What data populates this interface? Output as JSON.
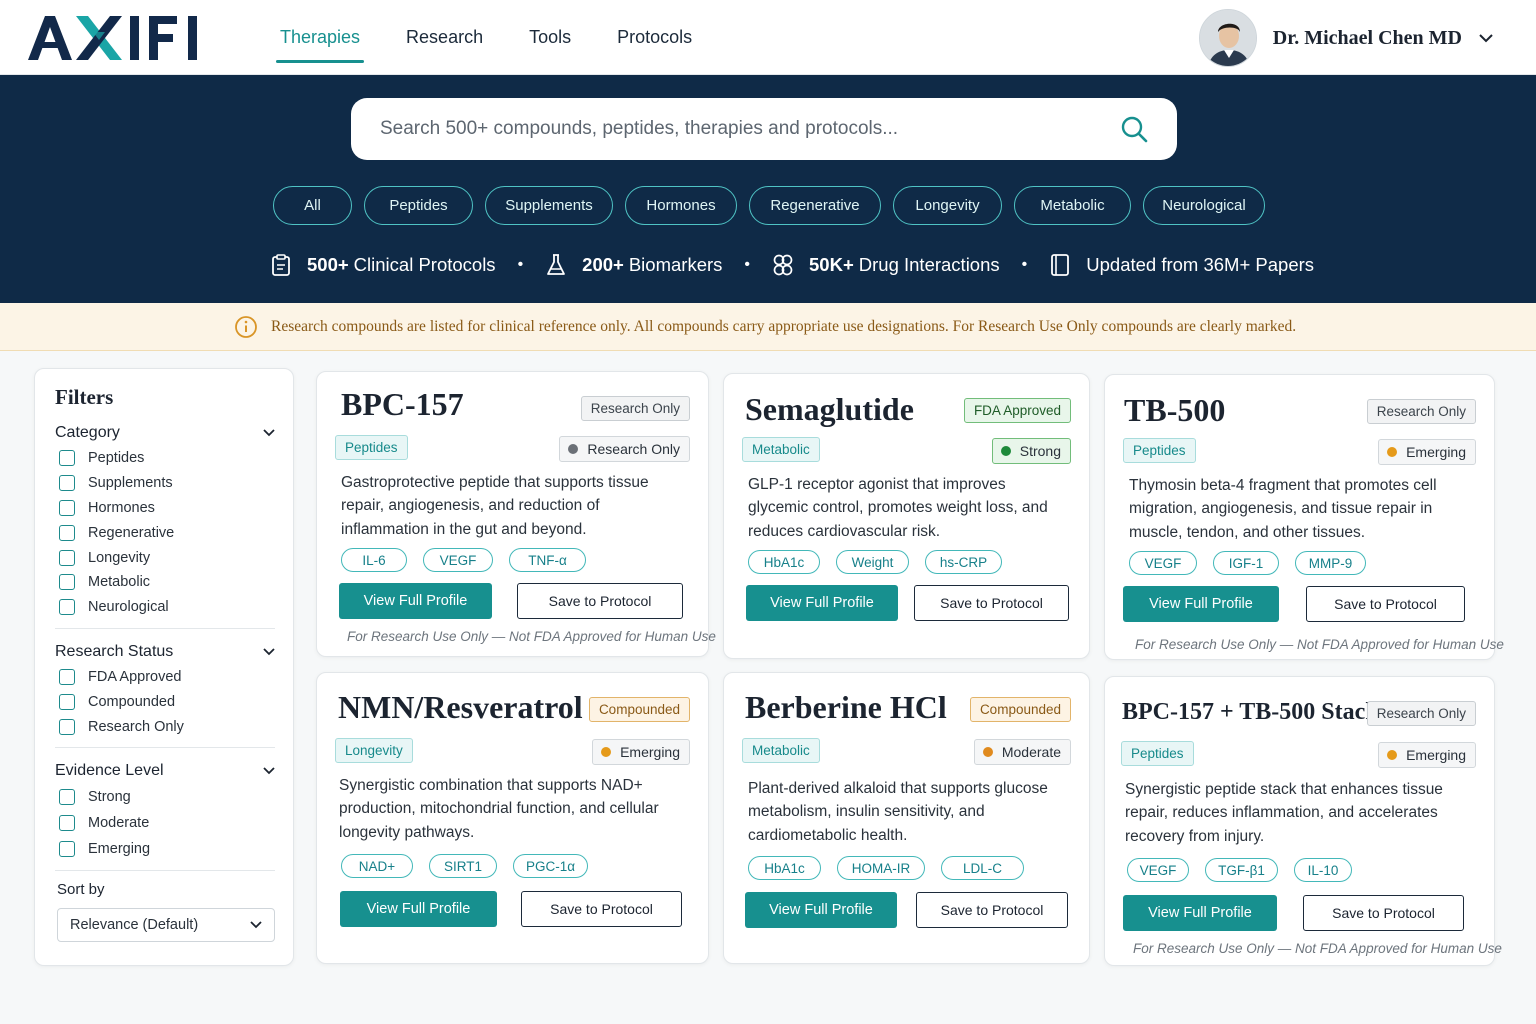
{
  "brand": {
    "logo_text": "AXIFI"
  },
  "nav": {
    "tabs": [
      {
        "label": "Therapies",
        "active": true
      },
      {
        "label": "Research",
        "active": false
      },
      {
        "label": "Tools",
        "active": false
      },
      {
        "label": "Protocols",
        "active": false
      }
    ]
  },
  "user": {
    "name": "Dr. Michael Chen MD"
  },
  "search": {
    "placeholder": "Search 500+ compounds, peptides, therapies and protocols..."
  },
  "chips": [
    "All",
    "Peptides",
    "Supplements",
    "Hormones",
    "Regenerative",
    "Longevity",
    "Metabolic",
    "Neurological"
  ],
  "stats": [
    {
      "icon": "clipboard-icon",
      "bold": "500+",
      "text": "Clinical Protocols"
    },
    {
      "icon": "flask-icon",
      "bold": "200+",
      "text": "Biomarkers"
    },
    {
      "icon": "molecule-icon",
      "bold": "50K+",
      "text": "Drug Interactions"
    },
    {
      "icon": "book-icon",
      "bold": "",
      "text": "Updated from 36M+ Papers"
    }
  ],
  "notice": {
    "text": "Research compounds are listed for clinical reference only. All compounds carry appropriate use designations. For Research Use Only compounds are clearly marked."
  },
  "filters": {
    "title": "Filters",
    "groups": [
      {
        "label": "Category",
        "options": [
          "Peptides",
          "Supplements",
          "Hormones",
          "Regenerative",
          "Longevity",
          "Metabolic",
          "Neurological"
        ]
      },
      {
        "label": "Research Status",
        "options": [
          "FDA Approved",
          "Compounded",
          "Research Only"
        ]
      },
      {
        "label": "Evidence Level",
        "options": [
          "Strong",
          "Moderate",
          "Emerging"
        ]
      }
    ],
    "sort_label": "Sort by",
    "sort_value": "Relevance (Default)"
  },
  "cards": [
    {
      "title": "BPC-157",
      "status": "Research Only",
      "status_type": "research",
      "category": "Peptides",
      "evidence": "Research Only",
      "evidence_type": "research",
      "description": "Gastroprotective peptide that supports tissue repair, angiogenesis, and reduction of inflammation in the gut and beyond.",
      "markers": [
        "IL-6",
        "VEGF",
        "TNF-α"
      ],
      "primary": "View Full Profile",
      "secondary": "Save to Protocol",
      "disclaimer": "For Research Use Only — Not FDA Approved for Human Use"
    },
    {
      "title": "Semaglutide",
      "status": "FDA Approved",
      "status_type": "fda",
      "category": "Metabolic",
      "evidence": "Strong",
      "evidence_type": "strong",
      "description": "GLP-1 receptor agonist that improves glycemic control, promotes weight loss, and reduces cardiovascular risk.",
      "markers": [
        "HbA1c",
        "Weight",
        "hs-CRP"
      ],
      "primary": "View Full Profile",
      "secondary": "Save to Protocol",
      "disclaimer": ""
    },
    {
      "title": "TB-500",
      "status": "Research Only",
      "status_type": "research",
      "category": "Peptides",
      "evidence": "Emerging",
      "evidence_type": "emerging",
      "description": "Thymosin beta-4 fragment that promotes cell migration, angiogenesis, and tissue repair in muscle, tendon, and other tissues.",
      "markers": [
        "VEGF",
        "IGF-1",
        "MMP-9"
      ],
      "primary": "View Full Profile",
      "secondary": "Save to Protocol",
      "disclaimer": "For Research Use Only — Not FDA Approved for Human Use"
    },
    {
      "title": "NMN/Resveratrol",
      "status": "Compounded",
      "status_type": "compounded",
      "category": "Longevity",
      "evidence": "Emerging",
      "evidence_type": "emerging",
      "description": "Synergistic combination that supports NAD+ production, mitochondrial function, and cellular longevity pathways.",
      "markers": [
        "NAD+",
        "SIRT1",
        "PGC-1α"
      ],
      "primary": "View Full Profile",
      "secondary": "Save to Protocol",
      "disclaimer": ""
    },
    {
      "title": "Berberine HCl",
      "status": "Compounded",
      "status_type": "compounded",
      "category": "Metabolic",
      "evidence": "Moderate",
      "evidence_type": "moderate",
      "description": "Plant-derived alkaloid that supports glucose metabolism, insulin sensitivity, and cardiometabolic health.",
      "markers": [
        "HbA1c",
        "HOMA-IR",
        "LDL-C"
      ],
      "primary": "View Full Profile",
      "secondary": "Save to Protocol",
      "disclaimer": ""
    },
    {
      "title": "BPC-157 + TB-500 Stack",
      "status": "Research Only",
      "status_type": "research",
      "category": "Peptides",
      "evidence": "Emerging",
      "evidence_type": "emerging",
      "description": "Synergistic peptide stack that enhances tissue repair, reduces inflammation, and accelerates recovery from injury.",
      "markers": [
        "VEGF",
        "TGF-β1",
        "IL-10"
      ],
      "primary": "View Full Profile",
      "secondary": "Save to Protocol",
      "disclaimer": "For Research Use Only — Not FDA Approved for Human Use"
    }
  ],
  "colors": {
    "accent": "#17908f",
    "navy": "#0f2a47",
    "emerging_dot": "#e59a1a",
    "moderate_dot": "#e08a1e",
    "strong_dot": "#1e8a3a",
    "research_dot": "#6b7077"
  }
}
